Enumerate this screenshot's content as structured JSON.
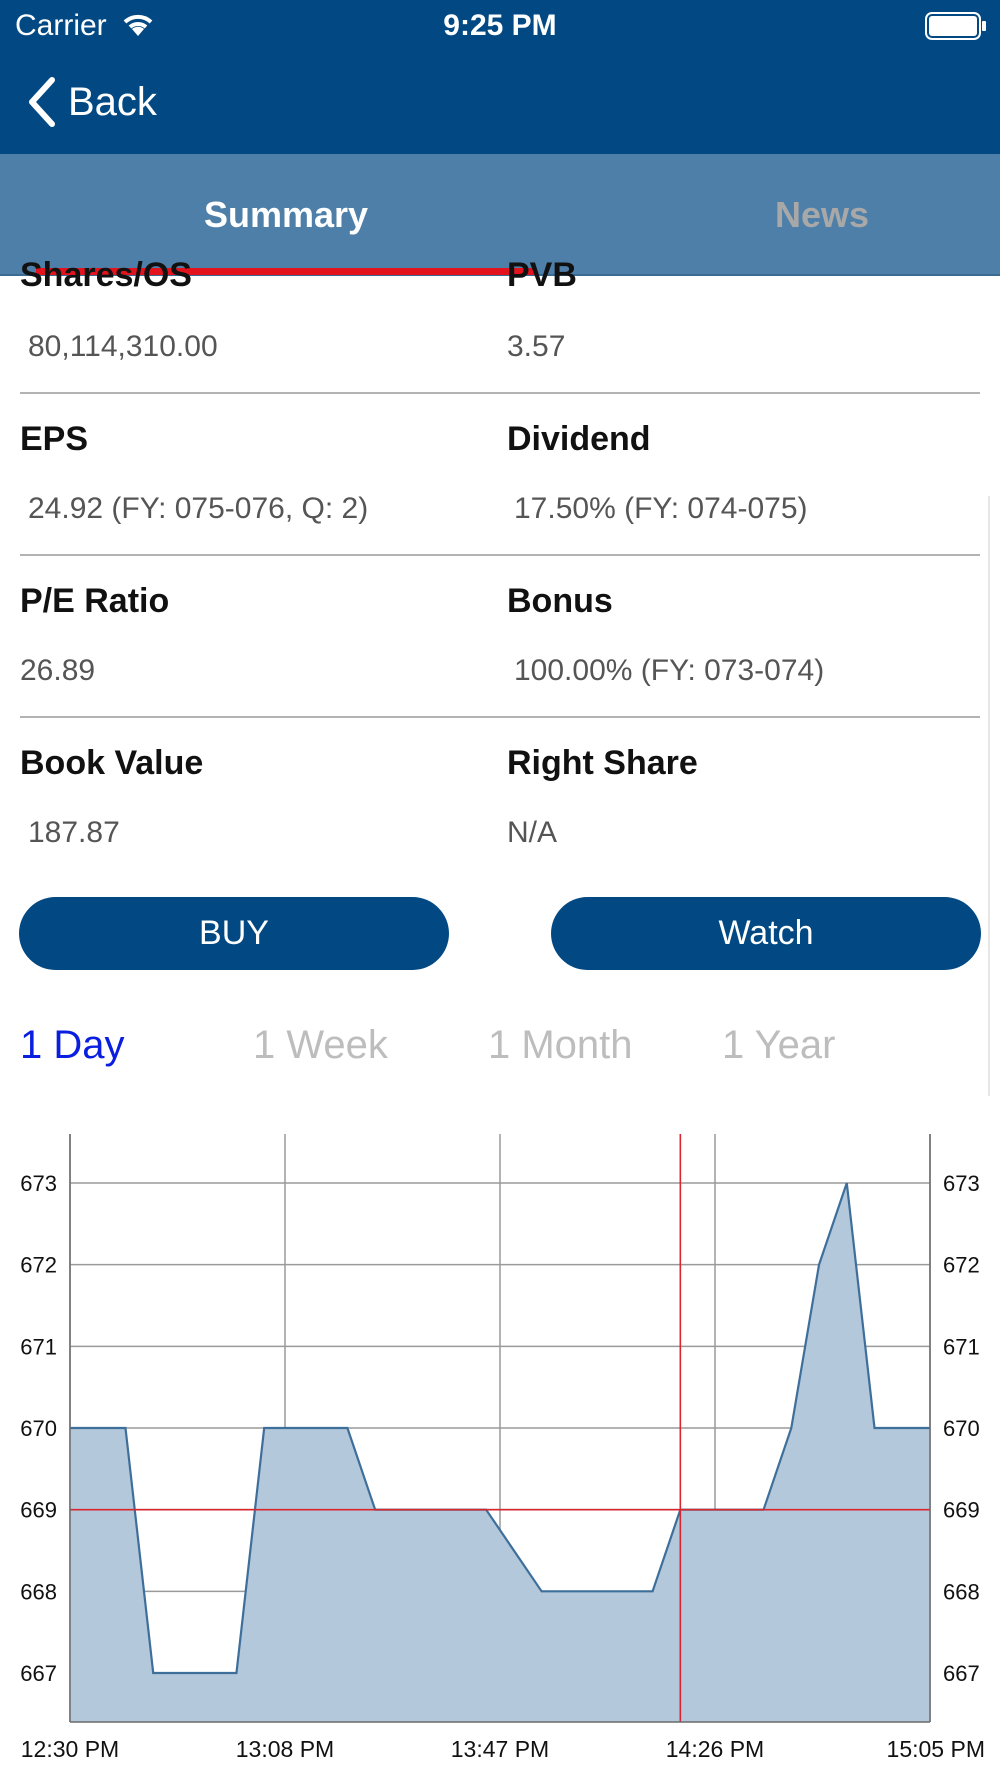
{
  "status_bar": {
    "carrier": "Carrier",
    "time": "9:25 PM"
  },
  "nav": {
    "back_label": "Back"
  },
  "tabs": [
    {
      "label": "Summary",
      "active": true
    },
    {
      "label": "News",
      "active": false
    }
  ],
  "summary": {
    "top_row": {
      "left": {
        "label": "Shares/OS",
        "value": "80,114,310.00"
      },
      "right": {
        "label": "PVB",
        "value": "3.57"
      }
    },
    "rows": [
      {
        "left": {
          "label": "EPS",
          "value": "24.92 (FY: 075-076, Q: 2)"
        },
        "right": {
          "label": "Dividend",
          "value": "17.50% (FY: 074-075)"
        }
      },
      {
        "left": {
          "label": "P/E Ratio",
          "value": "26.89"
        },
        "right": {
          "label": "Bonus",
          "value": "100.00% (FY: 073-074)"
        }
      },
      {
        "left": {
          "label": "Book Value",
          "value": "187.87"
        },
        "right": {
          "label": "Right Share",
          "value": "N/A"
        }
      }
    ]
  },
  "actions": {
    "buy_label": "BUY",
    "watch_label": "Watch"
  },
  "range_tabs": [
    {
      "label": "1 Day",
      "active": true
    },
    {
      "label": "1 Week",
      "active": false
    },
    {
      "label": "1 Month",
      "active": false
    },
    {
      "label": "1 Year",
      "active": false
    }
  ],
  "colors": {
    "header_bg": "#024983",
    "tab_bg": "#4e7fa8",
    "tab_indicator": "#e2131d",
    "button_bg": "#024983",
    "range_active": "#0a1ee0",
    "range_inactive": "#bdbdbd",
    "area_fill": "#b3c8da",
    "line": "#3e6f9b",
    "crosshair": "#d9262c"
  },
  "chart_data": {
    "type": "area",
    "title": "",
    "xlabel": "",
    "ylabel": "",
    "x_ticks": [
      "12:30 PM",
      "13:08 PM",
      "13:47 PM",
      "14:26 PM",
      "15:05 PM"
    ],
    "y_ticks": [
      667,
      668,
      669,
      670,
      671,
      672,
      673
    ],
    "ylim": [
      666.4,
      673.6
    ],
    "xlim": [
      0,
      155
    ],
    "grid": true,
    "right_axis_mirrored": true,
    "crosshair": {
      "x": 110,
      "y": 669
    },
    "series": [
      {
        "x": [
          0,
          10,
          15,
          30,
          35,
          50,
          55,
          70,
          75,
          85,
          90,
          105,
          110,
          125,
          130,
          135,
          140,
          145,
          155
        ],
        "values": [
          670,
          670,
          667,
          667,
          670,
          670,
          669,
          669,
          669,
          668,
          668,
          668,
          669,
          669,
          670,
          672,
          673,
          670,
          670
        ]
      }
    ]
  }
}
